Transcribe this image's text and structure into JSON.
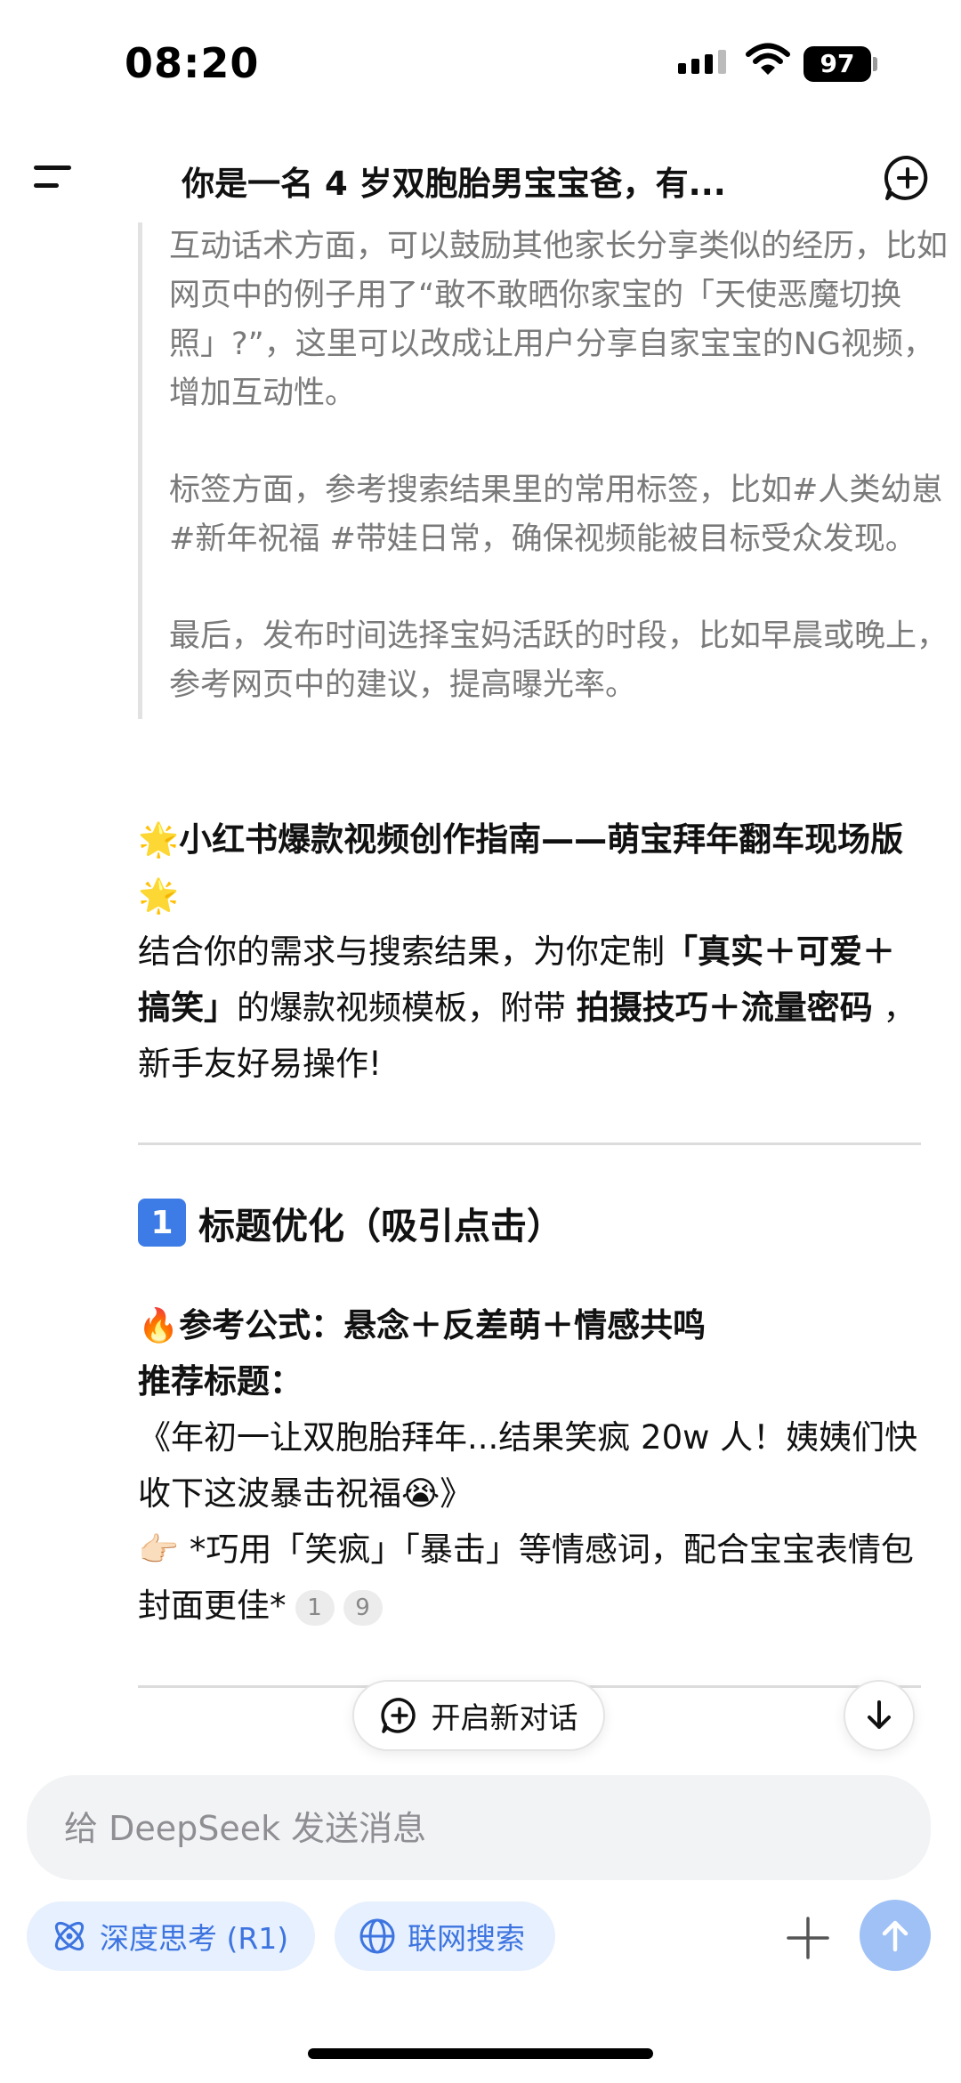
{
  "status_bar": {
    "time": "08:20",
    "battery": "97"
  },
  "header": {
    "title": "你是一名 4 岁双胞胎男宝宝爸，有..."
  },
  "quote": {
    "p1": "互动话术方面，可以鼓励其他家长分享类似的经历，比如网页中的例子用了“敢不敢晒你家宝的「天使恶魔切换照」?”，这里可以改成让用户分享自家宝宝的NG视频，增加互动性。",
    "p2": "标签方面，参考搜索结果里的常用标签，比如#人类幼崽 #新年祝福 #带娃日常，确保视频能被目标受众发现。",
    "p3": "最后，发布时间选择宝妈活跃的时段，比如早晨或晚上，参考网页中的建议，提高曝光率。"
  },
  "answer": {
    "title": "🌟小红书爆款视频创作指南——萌宝拜年翻车现场版🌟",
    "intro_1": "结合你的需求与搜索结果，为你定制",
    "intro_b1": "「真实＋可爱＋搞笑」",
    "intro_2": "的爆款视频模板，附带",
    "intro_b2": "拍摄技巧＋流量密码",
    "intro_3": "，新手友好易操作!",
    "section1": {
      "num": "1",
      "heading": "标题优化（吸引点击）",
      "formula_prefix": "🔥参考公式：",
      "formula_value": "悬念＋反差萌＋情感共鸣",
      "rec_label": "推荐标题：",
      "rec_title": "《年初一让双胞胎拜年...结果笑疯 20w 人！姨姨们快收下这波暴击祝福😭》",
      "tip": "👉🏻 *巧用「笑疯」「暴击」等情感词，配合宝宝表情包封面更佳*",
      "cites": [
        "1",
        "9"
      ]
    }
  },
  "floating": {
    "new_chat_label": "开启新对话"
  },
  "composer": {
    "placeholder": "给 DeepSeek 发送消息",
    "chip_deep_think": "深度思考 (R1)",
    "chip_web_search": "联网搜索"
  },
  "colors": {
    "accent": "#3d74e0",
    "chip_bg": "#e6f0fe",
    "send_disabled": "#9fc1f6"
  },
  "icons": [
    "menu-icon",
    "new-chat-icon",
    "chat-plus-icon",
    "arrow-down-icon",
    "atom-icon",
    "globe-icon",
    "plus-icon",
    "arrow-up-icon",
    "wifi-icon",
    "signal-icon",
    "battery-icon"
  ]
}
